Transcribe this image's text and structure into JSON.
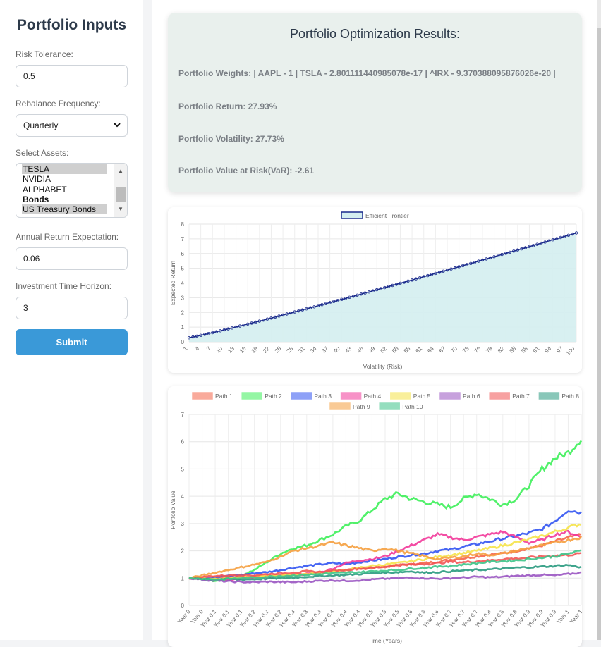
{
  "sidebar": {
    "title": "Portfolio Inputs",
    "risk_label": "Risk Tolerance:",
    "risk_value": "0.5",
    "rebalance_label": "Rebalance Frequency:",
    "rebalance_value": "Quarterly",
    "assets_label": "Select Assets:",
    "assets": [
      {
        "label": "TESLA",
        "selected": true,
        "bold": false
      },
      {
        "label": "NVIDIA",
        "selected": false,
        "bold": false
      },
      {
        "label": "ALPHABET",
        "selected": false,
        "bold": false
      },
      {
        "label": "Bonds",
        "selected": false,
        "bold": true
      },
      {
        "label": "US Treasury Bonds",
        "selected": true,
        "bold": false
      }
    ],
    "return_label": "Annual Return Expectation:",
    "return_value": "0.06",
    "horizon_label": "Investment Time Horizon:",
    "horizon_value": "3",
    "submit_label": "Submit"
  },
  "results": {
    "title": "Portfolio Optimization Results:",
    "weights": "Portfolio Weights: | AAPL - 1 | TSLA - 2.801111440985078e-17 | ^IRX - 9.370388095876026e-20 |",
    "return": "Portfolio Return: 27.93%",
    "volatility": "Portfolio Volatility: 27.73%",
    "var": "Portfolio Value at Risk(VaR): -2.61"
  },
  "chart_data": [
    {
      "type": "area",
      "legend": [
        "Efficient Frontier"
      ],
      "series": [
        {
          "name": "Efficient Frontier",
          "x_range": [
            1,
            100
          ],
          "y_start": 0.28,
          "y_end": 7.4
        }
      ],
      "x_ticks": [
        "1",
        "4",
        "7",
        "10",
        "13",
        "16",
        "19",
        "22",
        "25",
        "28",
        "31",
        "34",
        "37",
        "40",
        "43",
        "46",
        "49",
        "52",
        "55",
        "58",
        "61",
        "64",
        "67",
        "70",
        "73",
        "76",
        "79",
        "82",
        "85",
        "88",
        "91",
        "94",
        "97",
        "100"
      ],
      "y_ticks": [
        "0",
        "1",
        "2",
        "3",
        "4",
        "5",
        "6",
        "7",
        "8"
      ],
      "xlabel": "Volatility (Risk)",
      "ylabel": "Expected Return",
      "ylim": [
        0,
        8
      ],
      "grid": true,
      "colors": {
        "line": "#1a2a8c",
        "fill": "#d4eef0"
      }
    },
    {
      "type": "line",
      "xlabel": "Time (Years)",
      "ylabel": "Portfolio Value",
      "ylim": [
        0,
        7
      ],
      "y_ticks": [
        "0",
        "1",
        "2",
        "3",
        "4",
        "5",
        "6",
        "7"
      ],
      "x_ticks": [
        "Year 0",
        "Year 0",
        "Year 0.1",
        "Year 0.1",
        "Year 0.1",
        "Year 0.2",
        "Year 0.2",
        "Year 0.2",
        "Year 0.3",
        "Year 0.3",
        "Year 0.3",
        "Year 0.4",
        "Year 0.4",
        "Year 0.4",
        "Year 0.5",
        "Year 0.5",
        "Year 0.5",
        "Year 0.6",
        "Year 0.6",
        "Year 0.6",
        "Year 0.7",
        "Year 0.7",
        "Year 0.7",
        "Year 0.8",
        "Year 0.8",
        "Year 0.8",
        "Year 0.9",
        "Year 0.9",
        "Year 0.9",
        "Year 1",
        "Year 1"
      ],
      "grid": true,
      "series": [
        {
          "name": "Path 1",
          "color": "#f5664a",
          "values": [
            1.0,
            1.02,
            1.04,
            1.05,
            1.03,
            1.07,
            1.1,
            1.13,
            1.12,
            1.18,
            1.22,
            1.26,
            1.3,
            1.33,
            1.38,
            1.42,
            1.48,
            1.5,
            1.55,
            1.6,
            1.68,
            1.73,
            1.8,
            1.86,
            1.9,
            2.0,
            2.1,
            2.2,
            2.35,
            2.48,
            2.6
          ]
        },
        {
          "name": "Path 2",
          "color": "#3ef05a",
          "values": [
            1.0,
            0.95,
            0.9,
            0.95,
            1.1,
            1.3,
            1.6,
            1.9,
            2.1,
            2.2,
            2.4,
            2.6,
            2.9,
            3.1,
            3.5,
            3.9,
            4.1,
            3.9,
            3.8,
            3.7,
            3.6,
            3.9,
            4.1,
            3.9,
            3.7,
            3.9,
            4.4,
            5.0,
            5.4,
            5.6,
            6.1
          ]
        },
        {
          "name": "Path 3",
          "color": "#3355f2",
          "values": [
            1.0,
            1.02,
            1.05,
            1.08,
            1.12,
            1.18,
            1.22,
            1.3,
            1.38,
            1.45,
            1.5,
            1.55,
            1.52,
            1.58,
            1.65,
            1.7,
            1.78,
            1.85,
            1.9,
            2.0,
            2.05,
            2.15,
            2.25,
            2.35,
            2.45,
            2.55,
            2.65,
            2.8,
            3.1,
            3.5,
            3.4
          ]
        },
        {
          "name": "Path 4",
          "color": "#f23a9a",
          "values": [
            1.0,
            0.98,
            0.96,
            0.95,
            0.97,
            1.0,
            1.02,
            1.08,
            1.1,
            1.15,
            1.2,
            1.35,
            1.55,
            1.65,
            1.7,
            1.8,
            2.0,
            2.2,
            2.4,
            2.6,
            2.5,
            2.4,
            2.5,
            2.6,
            2.7,
            2.5,
            2.3,
            2.4,
            2.6,
            2.7,
            2.5
          ]
        },
        {
          "name": "Path 5",
          "color": "#f5e34a",
          "values": [
            1.0,
            1.0,
            0.98,
            1.0,
            1.02,
            1.05,
            1.08,
            1.1,
            1.12,
            1.15,
            1.2,
            1.25,
            1.3,
            1.38,
            1.45,
            1.5,
            1.55,
            1.62,
            1.7,
            1.78,
            1.85,
            1.92,
            2.0,
            2.1,
            2.2,
            2.3,
            2.42,
            2.55,
            2.7,
            2.85,
            3.0
          ]
        },
        {
          "name": "Path 6",
          "color": "#9a55c2",
          "values": [
            1.0,
            0.95,
            0.9,
            0.88,
            0.86,
            0.85,
            0.87,
            0.86,
            0.85,
            0.88,
            0.9,
            0.92,
            0.9,
            0.92,
            0.95,
            0.98,
            1.0,
            1.02,
            1.0,
            0.98,
            1.0,
            1.02,
            1.05,
            1.03,
            1.05,
            1.08,
            1.1,
            1.12,
            1.1,
            1.15,
            1.2
          ]
        },
        {
          "name": "Path 7",
          "color": "#f25555",
          "values": [
            1.0,
            1.05,
            1.08,
            1.1,
            1.12,
            1.1,
            1.15,
            1.18,
            1.2,
            1.25,
            1.22,
            1.28,
            1.3,
            1.35,
            1.38,
            1.42,
            1.48,
            1.5,
            1.52,
            1.55,
            1.6,
            1.58,
            1.62,
            1.65,
            1.7,
            1.72,
            1.75,
            1.8,
            1.82,
            1.85,
            1.9
          ]
        },
        {
          "name": "Path 8",
          "color": "#2a9a80",
          "values": [
            1.0,
            0.98,
            0.96,
            0.97,
            0.95,
            0.96,
            0.98,
            1.0,
            1.02,
            1.05,
            1.08,
            1.1,
            1.12,
            1.15,
            1.18,
            1.2,
            1.22,
            1.25,
            1.2,
            1.22,
            1.25,
            1.28,
            1.3,
            1.32,
            1.35,
            1.38,
            1.4,
            1.42,
            1.45,
            1.48,
            1.4
          ]
        },
        {
          "name": "Path 9",
          "color": "#f5a040",
          "values": [
            1.0,
            1.1,
            1.2,
            1.3,
            1.4,
            1.5,
            1.6,
            1.8,
            2.0,
            2.1,
            2.2,
            2.3,
            2.2,
            2.1,
            2.0,
            2.1,
            2.0,
            1.9,
            1.8,
            1.7,
            1.75,
            1.8,
            1.9,
            1.85,
            1.9,
            2.0,
            2.1,
            2.2,
            2.3,
            2.4,
            2.5
          ]
        },
        {
          "name": "Path 10",
          "color": "#3ec48a",
          "values": [
            1.0,
            0.98,
            0.95,
            0.97,
            1.0,
            1.02,
            1.05,
            1.08,
            1.1,
            1.12,
            1.15,
            1.18,
            1.2,
            1.22,
            1.25,
            1.28,
            1.3,
            1.35,
            1.38,
            1.42,
            1.45,
            1.5,
            1.55,
            1.6,
            1.62,
            1.65,
            1.7,
            1.75,
            1.8,
            1.9,
            2.0
          ]
        }
      ]
    }
  ]
}
